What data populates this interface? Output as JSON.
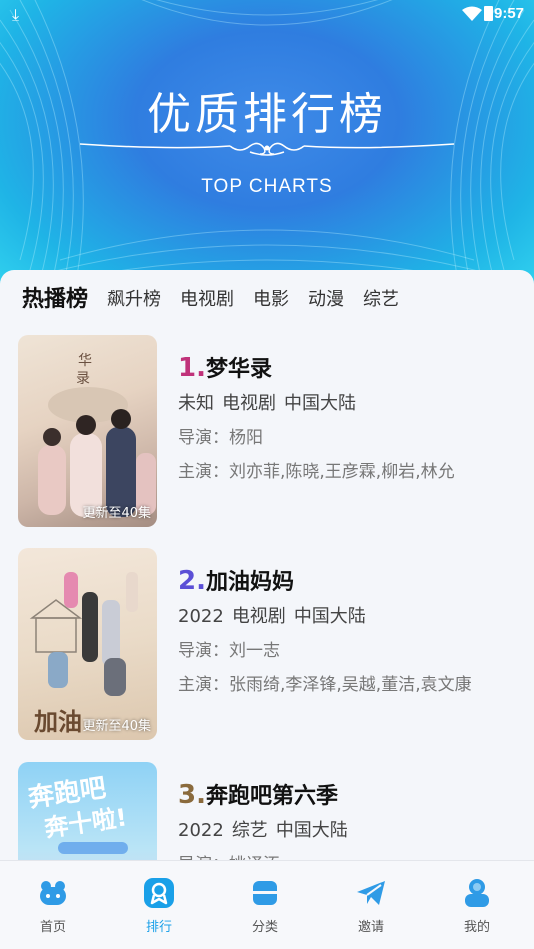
{
  "status_bar": {
    "time": "9:57"
  },
  "banner": {
    "title": "优质排行榜",
    "subtitle": "TOP CHARTS"
  },
  "tabs": [
    {
      "label": "热播榜",
      "active": true
    },
    {
      "label": "飙升榜",
      "active": false
    },
    {
      "label": "电视剧",
      "active": false
    },
    {
      "label": "电影",
      "active": false
    },
    {
      "label": "动漫",
      "active": false
    },
    {
      "label": "综艺",
      "active": false
    }
  ],
  "items": [
    {
      "rank": "1.",
      "rank_color": "#c0327a",
      "title": "梦华录",
      "year": "未知",
      "type": "电视剧",
      "region": "中国大陆",
      "director": "导演：杨阳",
      "cast": "主演：刘亦菲,陈晓,王彦霖,柳岩,林允",
      "badge": "更新至40集"
    },
    {
      "rank": "2.",
      "rank_color": "#5b4fd6",
      "title": "加油妈妈",
      "year": "2022",
      "type": "电视剧",
      "region": "中国大陆",
      "director": "导演：刘一志",
      "cast": "主演：张雨绮,李泽锋,吴越,董洁,袁文康",
      "badge": "更新至40集"
    },
    {
      "rank": "3.",
      "rank_color": "#8a6a3c",
      "title": "奔跑吧第六季",
      "year": "2022",
      "type": "综艺",
      "region": "中国大陆",
      "director": "导演：姚译添",
      "cast": "",
      "badge": ""
    }
  ],
  "bottom_nav": [
    {
      "label": "首页",
      "icon": "home-icon",
      "active": false
    },
    {
      "label": "排行",
      "icon": "ranking-icon",
      "active": true
    },
    {
      "label": "分类",
      "icon": "category-icon",
      "active": false
    },
    {
      "label": "邀请",
      "icon": "invite-icon",
      "active": false
    },
    {
      "label": "我的",
      "icon": "profile-icon",
      "active": false
    }
  ],
  "colors": {
    "accent": "#1aa0e8"
  }
}
